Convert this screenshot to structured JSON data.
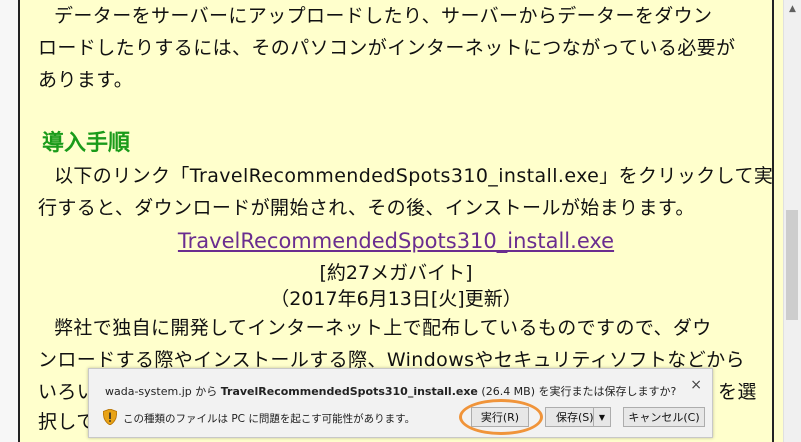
{
  "content": {
    "para1": [
      "データーをサーバーにアップロードしたり、サーバーからデーターをダウン",
      "ロードしたりするには、そのパソコンがインターネットにつながっている必要が",
      "あります。"
    ],
    "heading": "導入手順",
    "para2": [
      "以下のリンク「TravelRecommendedSpots310_install.exe」をクリックして実",
      "行すると、ダウンロードが開始され、その後、インストールが始まります。"
    ],
    "download_link": "TravelRecommendedSpots310_install.exe",
    "size_note": "[約27メガバイト]",
    "date_note": "（2017年6月13日[火]更新）",
    "para3": [
      "弊社で独自に開発してインターネット上で配布しているものですので、ダウ",
      "ンロードする際やインストールする際、Windowsやセキュリティソフトなどから",
      "いろい",
      "択して"
    ],
    "para3_tail": "を選"
  },
  "download_bar": {
    "site": "wada-system.jp",
    "from": " から ",
    "file": "TravelRecommendedSpots310_install.exe",
    "size": " (26.4 MB) ",
    "question": "を実行または保存しますか?",
    "warning": "この種類のファイルは PC に問題を起こす可能性があります。",
    "run_label": "実行(R)",
    "save_label": "保存(S)",
    "cancel_label": "キャンセル(C)",
    "close_glyph": "×",
    "dropdown_glyph": "▼"
  },
  "colors": {
    "page_bg": "#ffffcc",
    "heading": "#1a9b1a",
    "link": "#6a2d8f",
    "highlight": "#f0943a"
  }
}
